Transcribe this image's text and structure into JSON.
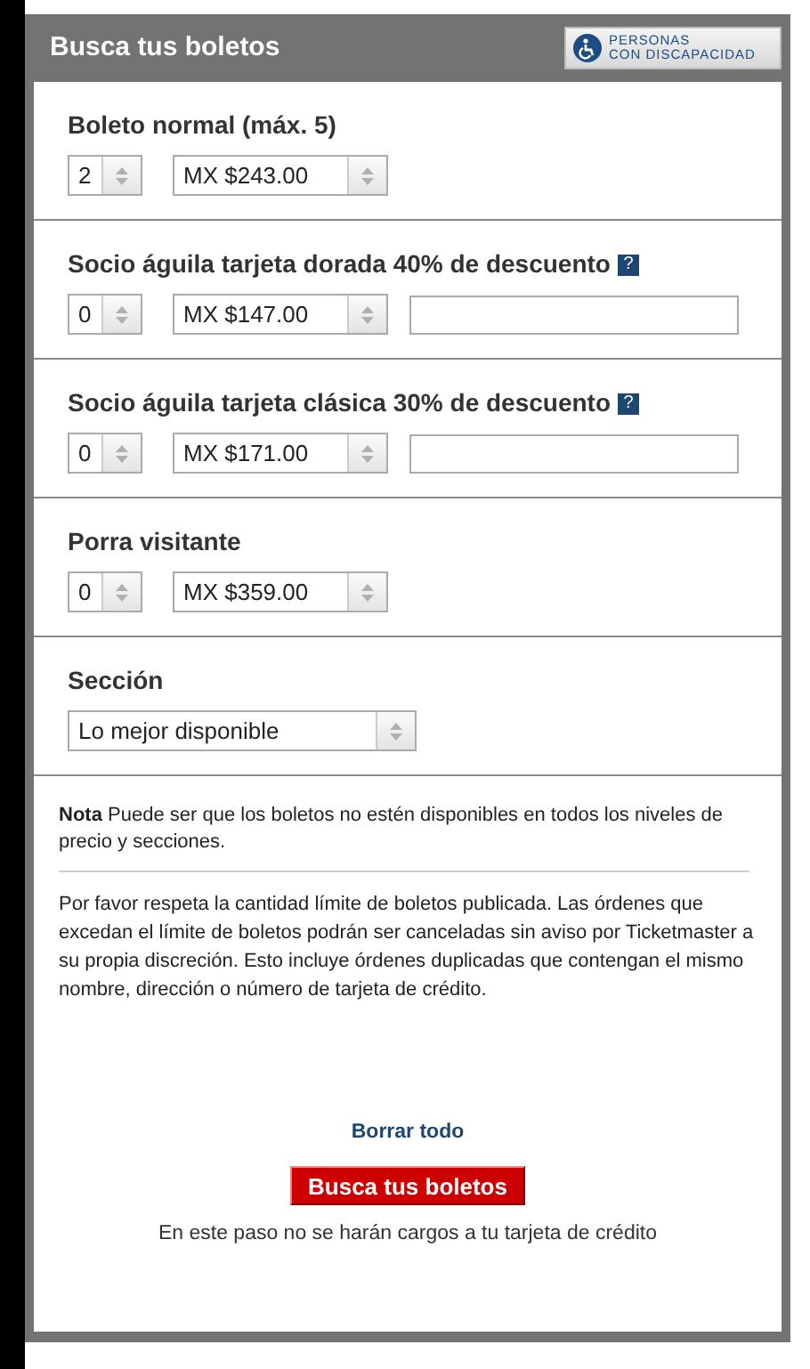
{
  "header": {
    "title": "Busca tus boletos",
    "accessibility_badge": [
      "PERSONAS",
      "CON DISCAPACIDAD"
    ]
  },
  "sections": [
    {
      "kind": "ticket",
      "label": "Boleto normal (máx. 5)",
      "quantity": "2",
      "price": "MX $243.00"
    },
    {
      "kind": "ticket",
      "label": "Socio águila tarjeta dorada 40% de descuento",
      "help": "?",
      "quantity": "0",
      "price": "MX $147.00",
      "code_field": true
    },
    {
      "kind": "ticket",
      "label": "Socio águila tarjeta clásica 30% de descuento",
      "help": "?",
      "quantity": "0",
      "price": "MX $171.00",
      "code_field": true
    },
    {
      "kind": "ticket",
      "label": "Porra visitante",
      "quantity": "0",
      "price": "MX $359.00"
    },
    {
      "kind": "select",
      "label": "Sección",
      "value": "Lo mejor disponible"
    }
  ],
  "notes": [
    "**Nota** Puede ser que los boletos no estén disponibles en todos los niveles de precio y secciones.",
    "Por favor respeta la cantidad límite de boletos publicada. Las órdenes que excedan el límite de boletos podrán ser canceladas sin aviso por Ticketmaster a su propia discreción. Esto incluye órdenes duplicadas que contengan el mismo nombre, dirección o número de tarjeta de crédito."
  ],
  "clear_link": "Borrar todo",
  "submit_button": "Busca tus boletos",
  "footnote": "En este paso no se harán cargos a tu tarjeta de crédito"
}
